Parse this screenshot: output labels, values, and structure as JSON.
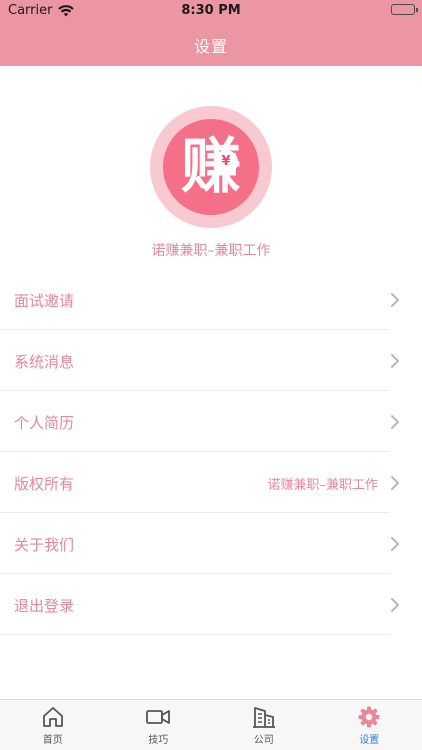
{
  "status_bar": {
    "carrier": "Carrier",
    "time": "8:30 PM"
  },
  "header": {
    "title": "设置"
  },
  "profile": {
    "logo_char": "赚",
    "logo_badge": "¥",
    "app_name": "诺赚兼职–兼职工作"
  },
  "menu": {
    "items": [
      {
        "label": "面试邀请",
        "value": ""
      },
      {
        "label": "系统消息",
        "value": ""
      },
      {
        "label": "个人简历",
        "value": ""
      },
      {
        "label": "版权所有",
        "value": "诺赚兼职–兼职工作"
      },
      {
        "label": "关于我们",
        "value": ""
      },
      {
        "label": "退出登录",
        "value": ""
      }
    ]
  },
  "tabbar": {
    "items": [
      {
        "label": "首页",
        "icon": "home-icon"
      },
      {
        "label": "技巧",
        "icon": "video-icon"
      },
      {
        "label": "公司",
        "icon": "building-icon"
      },
      {
        "label": "设置",
        "icon": "gear-icon"
      }
    ],
    "active_index": 3
  },
  "colors": {
    "brand": "#ec95a3",
    "text": "#e28a9b",
    "active_tab": "#2f7de1"
  }
}
